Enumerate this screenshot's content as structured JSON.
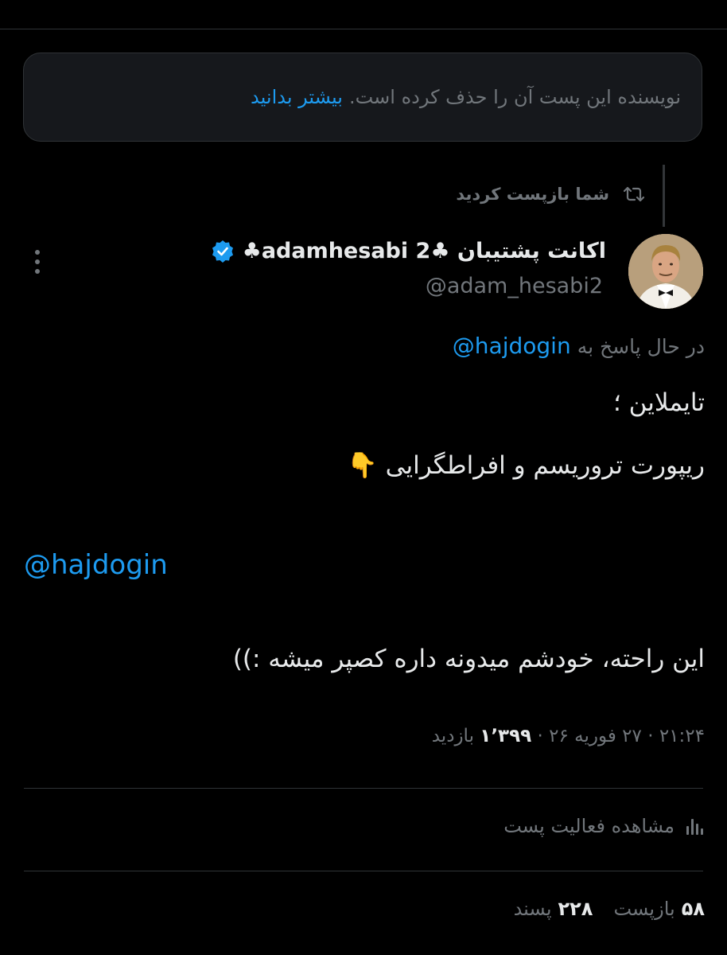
{
  "notice": {
    "text": "نویسنده این پست آن را حذف کرده است.",
    "learn_more": "بیشتر بدانید"
  },
  "repost_indicator": {
    "text": "شما بازپست کردید",
    "icon": "repost-icon"
  },
  "author": {
    "display_name": "اکانت پشتیبان ♣adamhesabi 2♣",
    "handle": "@adam_hesabi2",
    "verified_icon": "verified-badge-icon",
    "avatar": "avatar-photo"
  },
  "reply": {
    "prefix": "در حال پاسخ به",
    "mention": "@hajdogin"
  },
  "body": {
    "line1": "تایملاین ؛",
    "line2": "ریپورت تروریسم و افراطگرایی 👇",
    "mention": "@hajdogin",
    "line4": "این راحته، خودشم میدونه داره کصپر میشه :))"
  },
  "meta": {
    "time": "۲۱:۲۴",
    "date": "۲۷ فوریه ۲۶",
    "views_count": "۱٬۳۹۹",
    "views_label": "بازدید",
    "separator": "·"
  },
  "activity": {
    "label": "مشاهده فعالیت پست",
    "icon": "analytics-icon"
  },
  "stats": {
    "reposts_count": "۵۸",
    "reposts_label": "بازپست",
    "likes_count": "۲۲۸",
    "likes_label": "پسند"
  },
  "colors": {
    "background": "#000000",
    "text": "#e7e9ea",
    "muted": "#71767b",
    "accent": "#1d9bf0"
  }
}
